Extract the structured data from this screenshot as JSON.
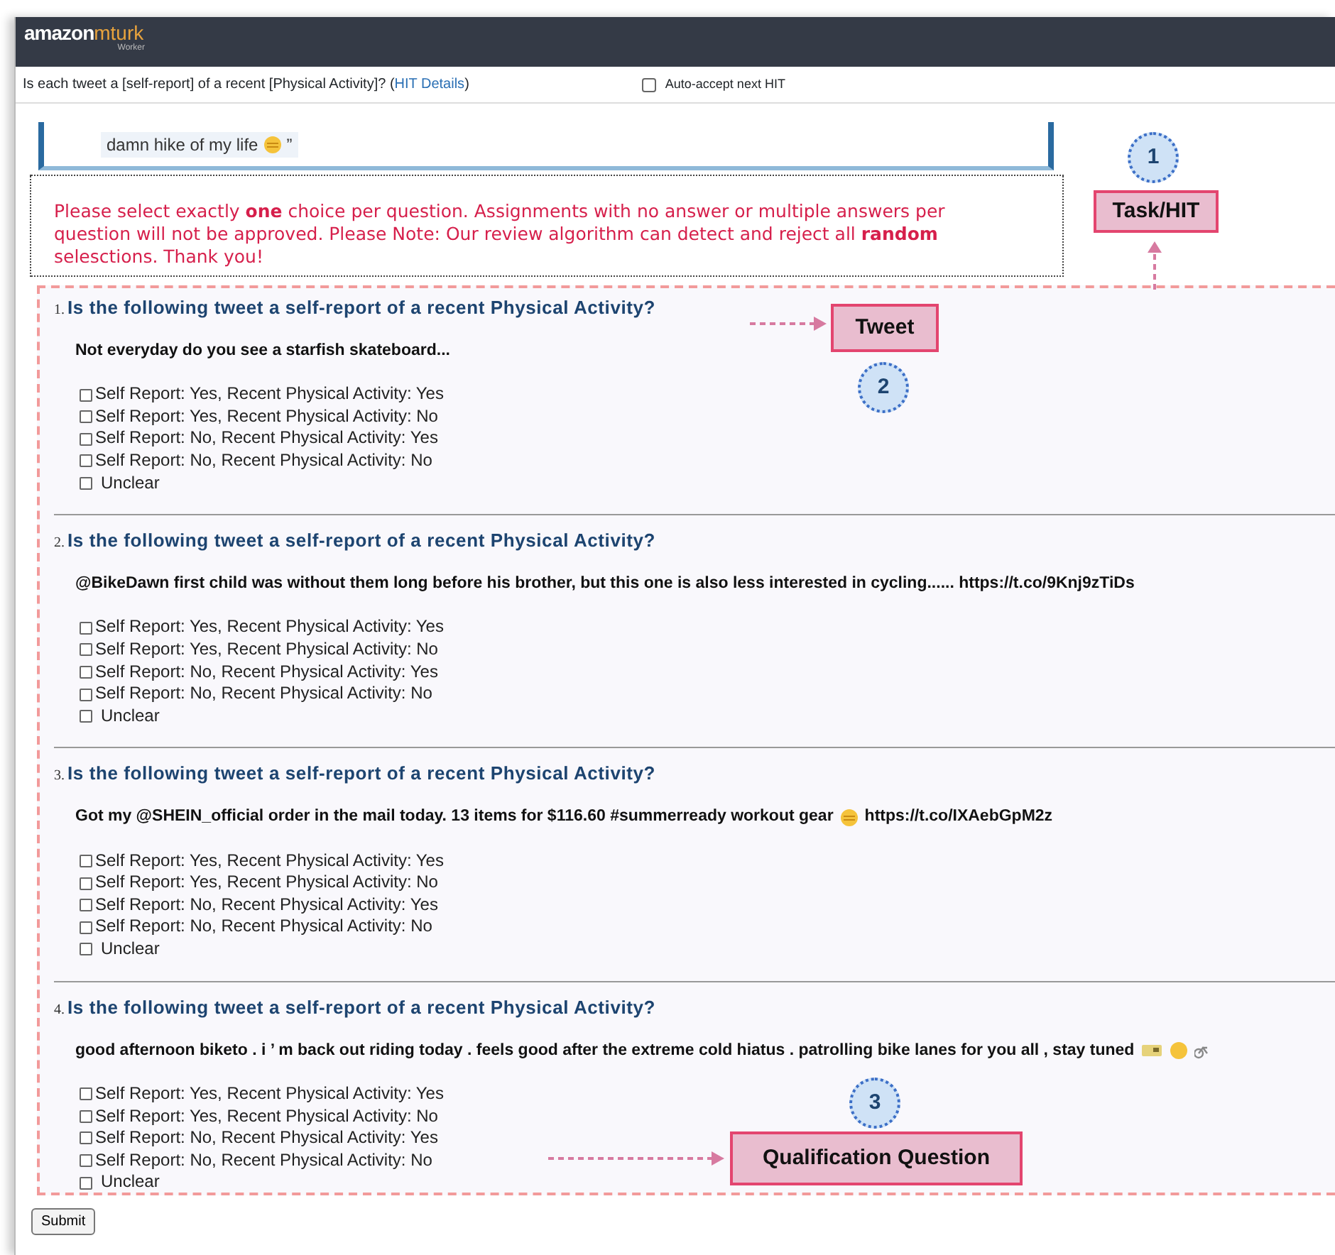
{
  "header": {
    "logo_main": "amazon",
    "logo_accent": "mturk",
    "logo_sub": "Worker"
  },
  "hit_bar": {
    "title": "Is each tweet a [self-report] of a recent [Physical Activity]? (",
    "link": "HIT Details",
    "title_end": ")",
    "auto_accept": {
      "label": "Auto-accept next HIT",
      "checked": false
    }
  },
  "tweet_fragment": {
    "text": "damn hike of my life",
    "end": "”"
  },
  "instructions": "Please select exactly **one** choice per question. Assignments with no answer or multiple answers per question will not be approved. Please Note: Our review algorithm can detect and reject all **random** selesctions. Thank you!",
  "questions": [
    {
      "number": "1.",
      "title": "Is the following tweet a self-report of a recent Physical Activity?",
      "tweet": "Not everyday do you see a starfish skateboard...",
      "options": [
        {
          "label": "Self Report: Yes, Recent Physical Activity: Yes",
          "checked": false
        },
        {
          "label": "Self Report: Yes, Recent Physical Activity: No",
          "checked": false
        },
        {
          "label": "Self Report: No, Recent Physical Activity: Yes",
          "checked": false
        },
        {
          "label": "Self Report: No, Recent Physical Activity: No",
          "checked": false
        },
        {
          "label": "Unclear",
          "checked": false
        }
      ]
    },
    {
      "number": "2.",
      "title": "Is the following tweet a self-report of a recent Physical Activity?",
      "tweet": "@BikeDawn first child was without them long before his brother, but this one is also less interested in cycling...... https://t.co/9Knj9zTiDs",
      "options": [
        {
          "label": "Self Report: Yes, Recent Physical Activity: Yes",
          "checked": false
        },
        {
          "label": "Self Report: Yes, Recent Physical Activity: No",
          "checked": false
        },
        {
          "label": "Self Report: No, Recent Physical Activity: Yes",
          "checked": false
        },
        {
          "label": "Self Report: No, Recent Physical Activity: No",
          "checked": false
        },
        {
          "label": "Unclear",
          "checked": false
        }
      ]
    },
    {
      "number": "3.",
      "title": "Is the following tweet a self-report of a recent Physical Activity?",
      "tweet": "Got my @SHEIN_official order in the mail today. 13 items for $116.60 #summerready workout gear",
      "tweet_end": "https://t.co/IXAebGpM2z",
      "options": [
        {
          "label": "Self Report: Yes, Recent Physical Activity: Yes",
          "checked": false
        },
        {
          "label": "Self Report: Yes, Recent Physical Activity: No",
          "checked": false
        },
        {
          "label": "Self Report: No, Recent Physical Activity: Yes",
          "checked": false
        },
        {
          "label": "Self Report: No, Recent Physical Activity: No",
          "checked": false
        },
        {
          "label": "Unclear",
          "checked": false
        }
      ]
    },
    {
      "number": "4.",
      "title": "Is the following tweet a self-report of a recent Physical Activity?",
      "tweet": "good afternoon biketo . i ’ m back out riding today . feels good after the extreme cold hiatus . patrolling bike lanes for you all , stay tuned",
      "options": [
        {
          "label": "Self Report: Yes, Recent Physical Activity: Yes",
          "checked": false
        },
        {
          "label": "Self Report: Yes, Recent Physical Activity: No",
          "checked": false
        },
        {
          "label": "Self Report: No, Recent Physical Activity: Yes",
          "checked": false
        },
        {
          "label": "Self Report: No, Recent Physical Activity: No",
          "checked": false
        },
        {
          "label": "Unclear",
          "checked": false
        }
      ]
    }
  ],
  "submit": "Submit",
  "annotations": [
    {
      "kind": "marker",
      "text": "1"
    },
    {
      "kind": "label",
      "text": "Task/HIT"
    },
    {
      "kind": "label",
      "text": "Tweet"
    },
    {
      "kind": "marker",
      "text": "2"
    },
    {
      "kind": "marker",
      "text": "3"
    },
    {
      "kind": "label",
      "text": "Qualification Question"
    }
  ]
}
